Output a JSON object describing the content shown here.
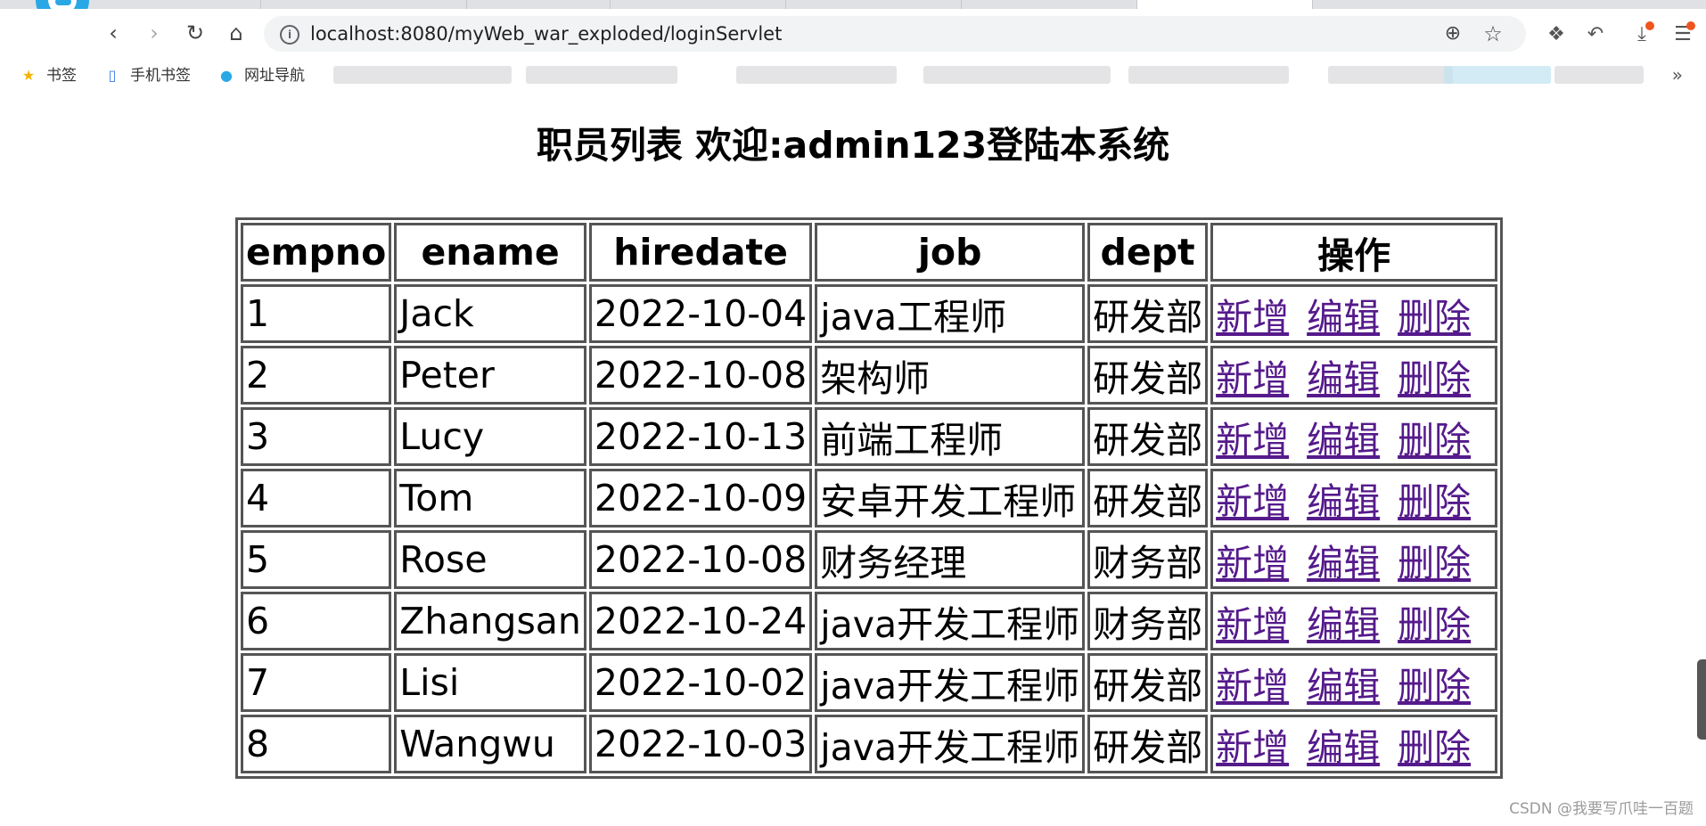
{
  "browser": {
    "url": "localhost:8080/myWeb_war_exploded/loginServlet",
    "bookmarks": [
      {
        "label": "书签"
      },
      {
        "label": "手机书签"
      },
      {
        "label": "网址导航"
      }
    ],
    "more_label": "»"
  },
  "page": {
    "title": "职员列表 欢迎:admin123登陆本系统",
    "table": {
      "headers": [
        "empno",
        "ename",
        "hiredate",
        "job",
        "dept",
        "操作"
      ],
      "rows": [
        {
          "empno": "1",
          "ename": "Jack",
          "hiredate": "2022-10-04",
          "job": "java工程师",
          "dept": "研发部"
        },
        {
          "empno": "2",
          "ename": "Peter",
          "hiredate": "2022-10-08",
          "job": "架构师",
          "dept": "研发部"
        },
        {
          "empno": "3",
          "ename": "Lucy",
          "hiredate": "2022-10-13",
          "job": "前端工程师",
          "dept": "研发部"
        },
        {
          "empno": "4",
          "ename": "Tom",
          "hiredate": "2022-10-09",
          "job": "安卓开发工程师",
          "dept": "研发部"
        },
        {
          "empno": "5",
          "ename": "Rose",
          "hiredate": "2022-10-08",
          "job": "财务经理",
          "dept": "财务部"
        },
        {
          "empno": "6",
          "ename": "Zhangsan",
          "hiredate": "2022-10-24",
          "job": "java开发工程师",
          "dept": "财务部"
        },
        {
          "empno": "7",
          "ename": "Lisi",
          "hiredate": "2022-10-02",
          "job": "java开发工程师",
          "dept": "研发部"
        },
        {
          "empno": "8",
          "ename": "Wangwu",
          "hiredate": "2022-10-03",
          "job": "java开发工程师",
          "dept": "研发部"
        }
      ],
      "actions": {
        "add": "新增",
        "edit": "编辑",
        "delete": "删除"
      }
    },
    "link_color": "#551a8b"
  },
  "watermark": "CSDN @我要写爪哇一百题"
}
